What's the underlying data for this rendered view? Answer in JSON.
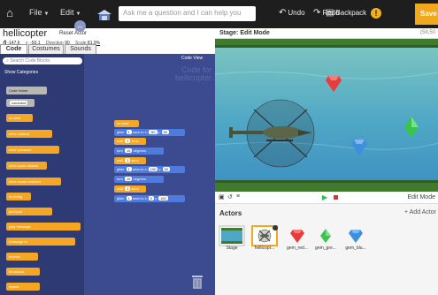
{
  "topbar": {
    "file_label": "File",
    "edit_label": "Edit",
    "ask_placeholder": "Ask me a question and I can help you",
    "undo_label": "Undo",
    "redo_label": "Redo",
    "backpack_label": "Backpack",
    "save_label": "Save"
  },
  "sprite": {
    "name": "hellicopter 1",
    "reset_label": "Reset Actor",
    "x_label": "x",
    "x_value": "-147.6",
    "y_label": "y",
    "y_value": "-50.1",
    "direction_label": "Direction",
    "direction_value": "90",
    "scale_label": "Scale",
    "scale_value": "81.9%"
  },
  "tabs": [
    "Code",
    "Costumes",
    "Sounds"
  ],
  "palette": {
    "search_placeholder": "Search Code Blocks",
    "show_categories": "Show Categories",
    "blocks": [
      "Code Home",
      "comment",
      "on start",
      "when clicked",
      "when pressed",
      "when actor clicked",
      "when scale matches",
      "touching",
      "and wait",
      "play message",
      "message to",
      "receive",
      "broadcast",
      "repeat",
      "wait"
    ]
  },
  "script": {
    "code_view": "Code View",
    "code_for": "Code for",
    "code_for_sprite": "hellicopter 1",
    "blocks": [
      {
        "kind": "orange",
        "label": "on start"
      },
      {
        "kind": "blue",
        "label": "glide",
        "a": "1",
        "mid": "secs to x:",
        "b": "-50",
        "c": "y:",
        "d": "50"
      },
      {
        "kind": "orange",
        "label": "wait",
        "a": "1",
        "mid": "secs"
      },
      {
        "kind": "blue",
        "label": "turn",
        "a": "15",
        "mid": "degrees"
      },
      {
        "kind": "orange",
        "label": "wait",
        "a": "1",
        "mid": "secs"
      },
      {
        "kind": "blue",
        "label": "glide",
        "a": "1",
        "mid": "secs to x:",
        "b": "100",
        "c": "y:",
        "d": "50"
      },
      {
        "kind": "blue",
        "label": "turn",
        "a": "15",
        "mid": "degrees"
      },
      {
        "kind": "orange",
        "label": "wait",
        "a": "1",
        "mid": "secs"
      },
      {
        "kind": "blue",
        "label": "glide",
        "a": "1",
        "mid": "secs to x:",
        "b": "0",
        "c": "y:",
        "d": "100"
      }
    ]
  },
  "stage": {
    "title": "Stage: Edit Mode",
    "coord": "(58,50",
    "edit_mode": "Edit Mode"
  },
  "actors": {
    "title": "Actors",
    "add_label": "Add Actor",
    "items": [
      {
        "label": "Stage"
      },
      {
        "label": "hellicopt...",
        "selected": true
      },
      {
        "label": "gem_red..."
      },
      {
        "label": "gem_gre..."
      },
      {
        "label": "gem_blu..."
      }
    ]
  },
  "colors": {
    "palette_bg": "#2e3a73",
    "script_bg": "#3c4b8f",
    "accent": "#f2a81d",
    "gem_red": "#e83b3b",
    "gem_green": "#39c44a",
    "gem_blue": "#3d8fe0"
  }
}
